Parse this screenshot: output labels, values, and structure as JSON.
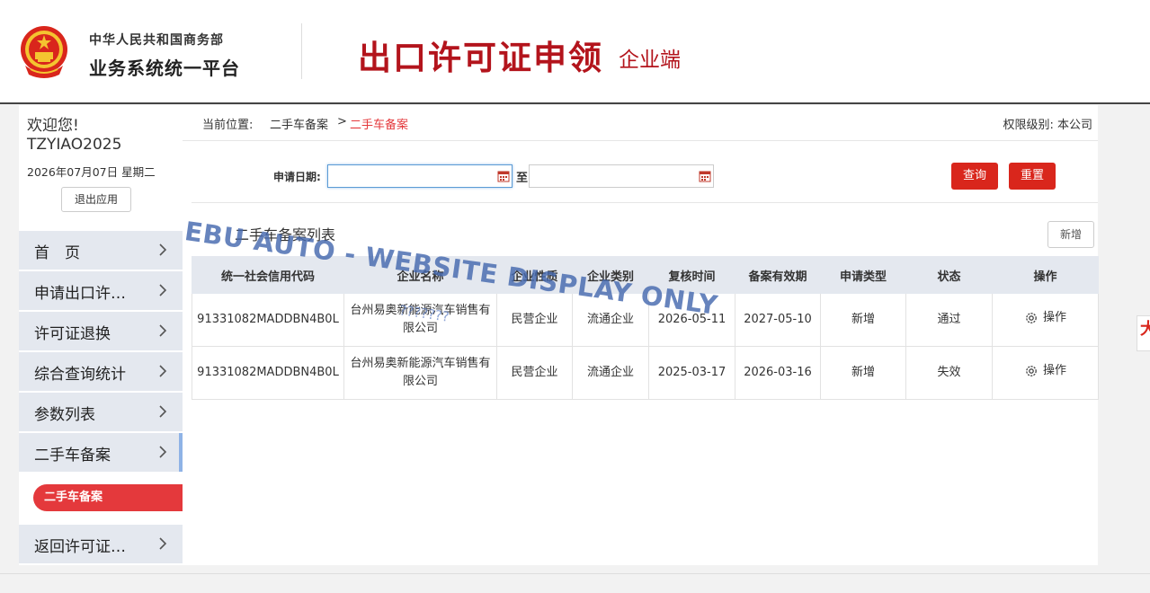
{
  "header": {
    "ministry": "中华人民共和国商务部",
    "platform": "业务系统统一平台",
    "app_title": "出口许可证申领",
    "app_subtitle": "企业端"
  },
  "sidebar": {
    "welcome": "欢迎您!",
    "username": "TZYIAO2025",
    "date": "2026年07月07日 星期二",
    "logout_label": "退出应用",
    "items": [
      {
        "label": "首　页"
      },
      {
        "label": "申请出口许…"
      },
      {
        "label": "许可证退换"
      },
      {
        "label": "综合查询统计"
      },
      {
        "label": "参数列表"
      },
      {
        "label": "二手车备案"
      },
      {
        "label": "返回许可证…"
      }
    ],
    "sub_item": "二手车备案"
  },
  "breadcrumb": {
    "label": "当前位置:",
    "level1": "二手车备案",
    "separator": ">",
    "level2": "二手车备案",
    "permission": "权限级别: 本公司"
  },
  "search": {
    "date_label": "申请日期:",
    "to_label": "至",
    "start_value": "",
    "end_value": "",
    "query_label": "查询",
    "reset_label": "重置"
  },
  "list": {
    "title": "二手车备案列表",
    "add_label": "新增",
    "columns": [
      "统一社会信用代码",
      "企业名称",
      "企业性质",
      "企业类别",
      "复核时间",
      "备案有效期",
      "申请类型",
      "状态",
      "操作"
    ],
    "rows": [
      {
        "code": "91331082MADDBN4B0L",
        "name": "台州易奥新能源汽车销售有限公司",
        "nature": "民营企业",
        "category": "流通企业",
        "review_time": "2026-05-11",
        "valid_until": "2027-05-10",
        "apply_type": "新增",
        "status": "通过",
        "action": "操作"
      },
      {
        "code": "91331082MADDBN4B0L",
        "name": "台州易奥新能源汽车销售有限公司",
        "nature": "民营企业",
        "category": "流通企业",
        "review_time": "2025-03-17",
        "valid_until": "2026-03-16",
        "apply_type": "新增",
        "status": "失效",
        "action": "操作"
      }
    ]
  },
  "overlay": {
    "watermark": "EBU AUTO - WEBSITE DISPLAY ONLY",
    "garble": "???????"
  },
  "side_tab_glyph": "大",
  "colors": {
    "brand_red": "#b3141c",
    "button_red": "#d9261c",
    "active_red": "#e4393c",
    "menu_bg": "#e4e8ef"
  }
}
